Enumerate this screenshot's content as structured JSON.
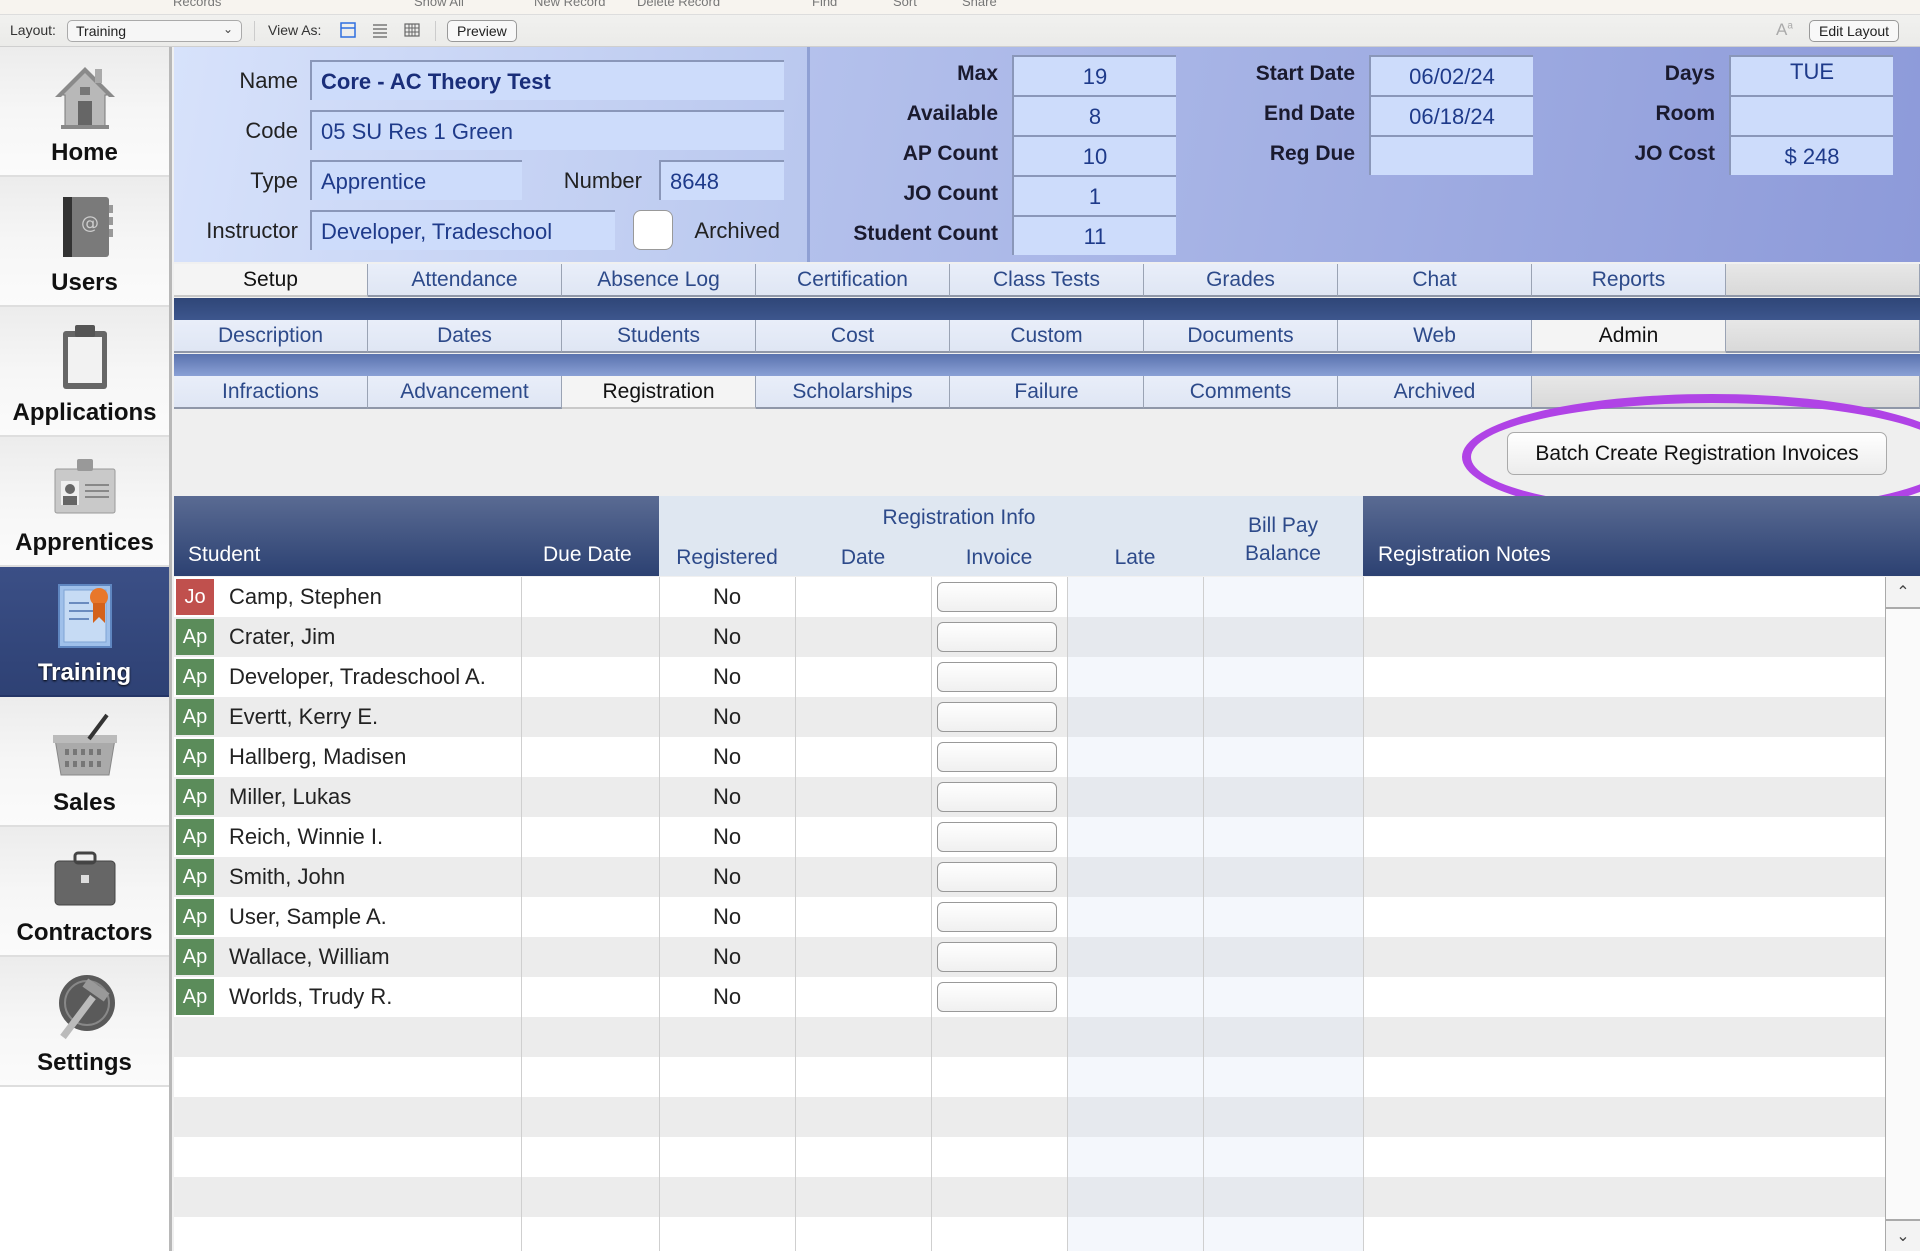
{
  "top_strip": [
    "Records",
    "Show All",
    "New Record",
    "Delete Record",
    "Find",
    "Sort",
    "Share"
  ],
  "toolbar": {
    "layout_label": "Layout:",
    "layout_value": "Training",
    "view_as_label": "View As:",
    "view_modes": [
      "form-view-icon",
      "list-view-icon",
      "table-view-icon"
    ],
    "active_view": "form-view-icon",
    "preview_label": "Preview",
    "edit_layout_label": "Edit Layout",
    "font_size_glyph": "A"
  },
  "sidebar": {
    "items": [
      {
        "label": "Home",
        "icon": "house-icon",
        "active": false
      },
      {
        "label": "Users",
        "icon": "address-book-icon",
        "active": false
      },
      {
        "label": "Applications",
        "icon": "clipboard-icon",
        "active": false
      },
      {
        "label": "Apprentices",
        "icon": "id-badge-icon",
        "active": false
      },
      {
        "label": "Training",
        "icon": "certificate-icon",
        "active": true
      },
      {
        "label": "Sales",
        "icon": "basket-icon",
        "active": false
      },
      {
        "label": "Contractors",
        "icon": "briefcase-icon",
        "active": false
      },
      {
        "label": "Settings",
        "icon": "hammer-globe-icon",
        "active": false
      }
    ]
  },
  "record": {
    "name_label": "Name",
    "name": "Core - AC Theory Test",
    "code_label": "Code",
    "code": "05 SU Res 1  Green",
    "type_label": "Type",
    "type": "Apprentice",
    "number_label": "Number",
    "number": "8648",
    "instructor_label": "Instructor",
    "instructor": "Developer, Tradeschool",
    "archived_label": "Archived",
    "archived": false,
    "max_label": "Max",
    "max": "19",
    "available_label": "Available",
    "available": "8",
    "ap_count_label": "AP Count",
    "ap_count": "10",
    "jo_count_label": "JO Count",
    "jo_count": "1",
    "student_count_label": "Student Count",
    "student_count": "11",
    "start_date_label": "Start Date",
    "start_date": "06/02/24",
    "end_date_label": "End Date",
    "end_date": "06/18/24",
    "reg_due_label": "Reg Due",
    "reg_due": "",
    "days_label": "Days",
    "days": "TUE",
    "room_label": "Room",
    "room": "",
    "jo_cost_label": "JO Cost",
    "jo_cost": "$ 248"
  },
  "tabs_main": {
    "items": [
      "Setup",
      "Attendance",
      "Absence Log",
      "Certification",
      "Class Tests",
      "Grades",
      "Chat",
      "Reports"
    ],
    "selected": "Setup"
  },
  "tabs_setup": {
    "items": [
      "Description",
      "Dates",
      "Students",
      "Cost",
      "Custom",
      "Documents",
      "Web",
      "Admin"
    ],
    "selected": "Admin"
  },
  "tabs_admin": {
    "items": [
      "Infractions",
      "Advancement",
      "Registration",
      "Scholarships",
      "Failure",
      "Comments",
      "Archived"
    ],
    "selected": "Registration"
  },
  "batch_button_label": "Batch Create Registration Invoices",
  "highlight_color": "#b043e6",
  "table": {
    "group_header": "Registration Info",
    "columns": {
      "student": "Student",
      "due_date": "Due Date",
      "registered": "Registered",
      "date": "Date",
      "invoice": "Invoice",
      "late": "Late",
      "bill_pay_1": "Bill Pay",
      "bill_pay_2": "Balance",
      "notes": "Registration Notes"
    },
    "rows": [
      {
        "type": "Jo",
        "type_color": "#c0504d",
        "student": "Camp, Stephen",
        "due_date": "",
        "registered": "No",
        "date": "",
        "late": "",
        "balance": "",
        "notes": ""
      },
      {
        "type": "Ap",
        "type_color": "#5b8c5a",
        "student": "Crater, Jim",
        "due_date": "",
        "registered": "No",
        "date": "",
        "late": "",
        "balance": "",
        "notes": ""
      },
      {
        "type": "Ap",
        "type_color": "#5b8c5a",
        "student": "Developer, Tradeschool  A.",
        "due_date": "",
        "registered": "No",
        "date": "",
        "late": "",
        "balance": "",
        "notes": ""
      },
      {
        "type": "Ap",
        "type_color": "#5b8c5a",
        "student": "Evertt, Kerry  E.",
        "due_date": "",
        "registered": "No",
        "date": "",
        "late": "",
        "balance": "",
        "notes": ""
      },
      {
        "type": "Ap",
        "type_color": "#5b8c5a",
        "student": "Hallberg, Madisen",
        "due_date": "",
        "registered": "No",
        "date": "",
        "late": "",
        "balance": "",
        "notes": ""
      },
      {
        "type": "Ap",
        "type_color": "#5b8c5a",
        "student": "Miller, Lukas",
        "due_date": "",
        "registered": "No",
        "date": "",
        "late": "",
        "balance": "",
        "notes": ""
      },
      {
        "type": "Ap",
        "type_color": "#5b8c5a",
        "student": "Reich, Winnie  I.",
        "due_date": "",
        "registered": "No",
        "date": "",
        "late": "",
        "balance": "",
        "notes": ""
      },
      {
        "type": "Ap",
        "type_color": "#5b8c5a",
        "student": "Smith, John",
        "due_date": "",
        "registered": "No",
        "date": "",
        "late": "",
        "balance": "",
        "notes": ""
      },
      {
        "type": "Ap",
        "type_color": "#5b8c5a",
        "student": "User, Sample  A.",
        "due_date": "",
        "registered": "No",
        "date": "",
        "late": "",
        "balance": "",
        "notes": ""
      },
      {
        "type": "Ap",
        "type_color": "#5b8c5a",
        "student": "Wallace, William",
        "due_date": "",
        "registered": "No",
        "date": "",
        "late": "",
        "balance": "",
        "notes": ""
      },
      {
        "type": "Ap",
        "type_color": "#5b8c5a",
        "student": "Worlds, Trudy  R.",
        "due_date": "",
        "registered": "No",
        "date": "",
        "late": "",
        "balance": "",
        "notes": ""
      }
    ]
  }
}
